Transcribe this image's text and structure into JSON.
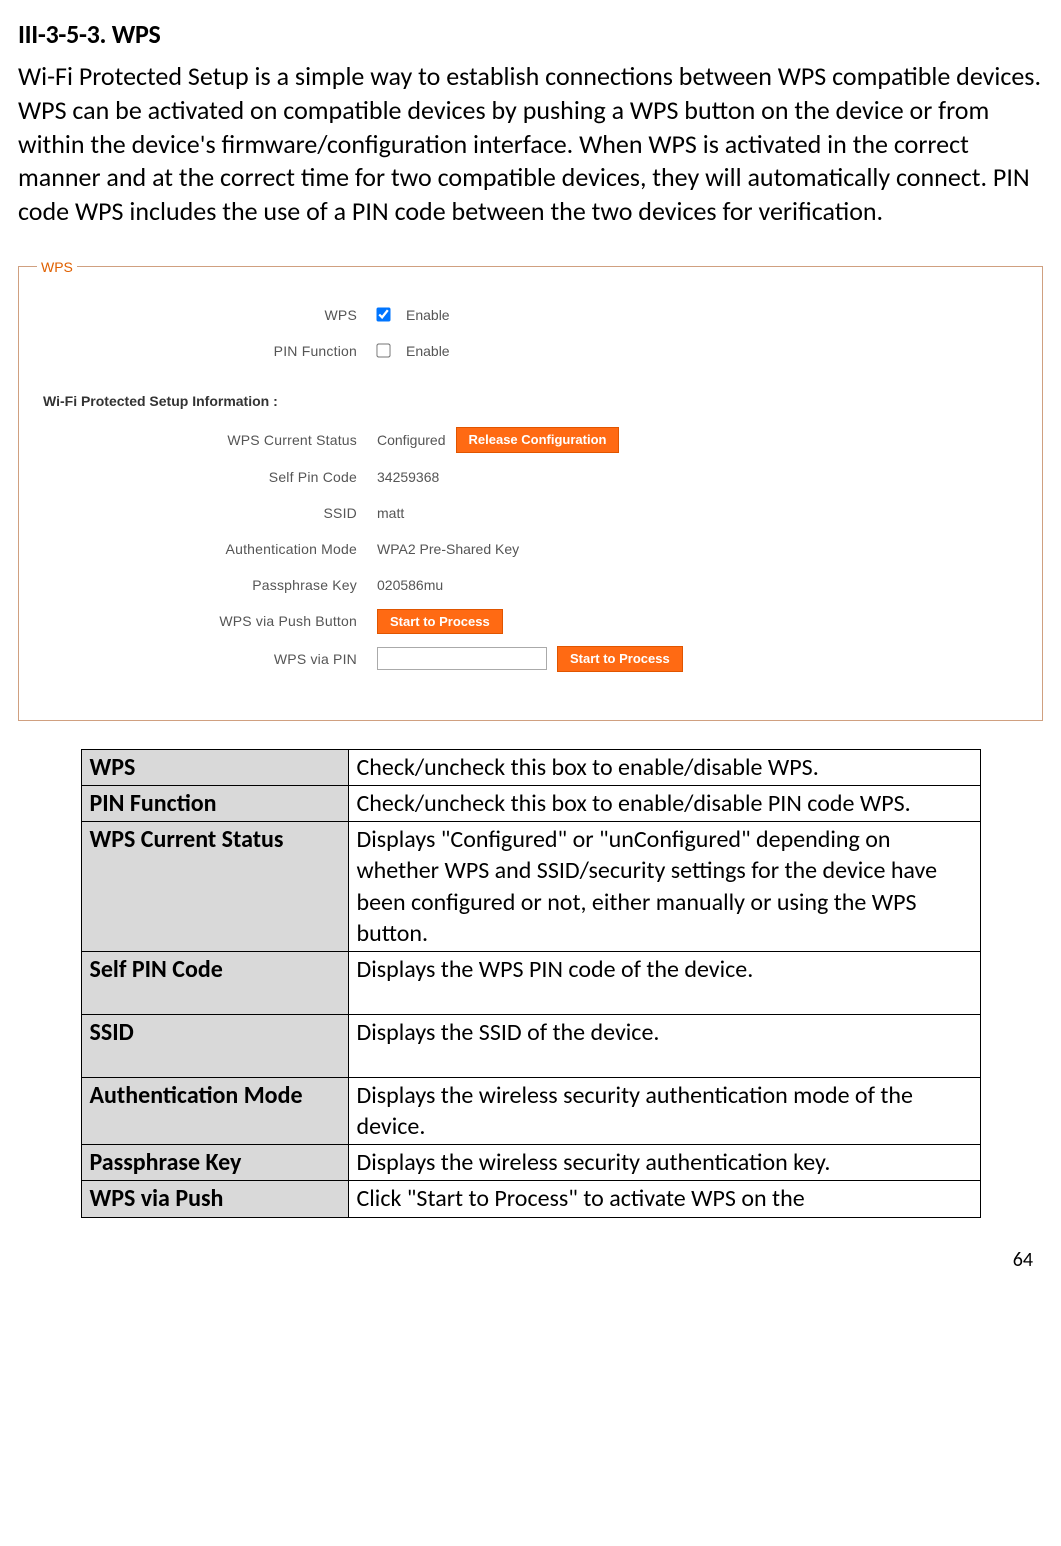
{
  "heading": "III-3-5-3.    WPS",
  "intro": "Wi-Fi Protected Setup is a simple way to establish connections between WPS compatible devices. WPS can be activated on compatible devices by pushing a WPS button on the device or from within the device's firmware/configuration interface. When WPS is activated in the correct manner and at the correct time for two compatible devices, they will automatically connect. PIN code WPS includes the use of a PIN code between the two devices for verification.",
  "fieldset": {
    "legend": "WPS",
    "rows": {
      "wps_label": "WPS",
      "wps_enable": "Enable",
      "pinfunc_label": "PIN Function",
      "pinfunc_enable": "Enable"
    },
    "info_head": "Wi-Fi Protected Setup Information   :",
    "info": {
      "status_label": "WPS Current Status",
      "status_value": "Configured",
      "status_btn": "Release Configuration",
      "selfpin_label": "Self Pin Code",
      "selfpin_value": "34259368",
      "ssid_label": "SSID",
      "ssid_value": "matt",
      "auth_label": "Authentication Mode",
      "auth_value": "WPA2 Pre-Shared Key",
      "pass_label": "Passphrase Key",
      "pass_value": "020586mu",
      "push_label": "WPS via Push Button",
      "push_btn": "Start to Process",
      "pin_label": "WPS via PIN",
      "pin_btn": "Start to Process"
    }
  },
  "table": [
    {
      "k": "WPS",
      "v": "Check/uncheck this box to enable/disable WPS."
    },
    {
      "k": "PIN Function",
      "v": "Check/uncheck this box to enable/disable PIN code WPS."
    },
    {
      "k": "WPS Current Status",
      "v": "Displays \"Configured\" or \"unConfigured\" depending on whether WPS and SSID/security settings for the device have been configured or not, either manually or using the WPS button."
    },
    {
      "k": "Self PIN Code",
      "v": "Displays the WPS PIN code of the device."
    },
    {
      "k": "SSID",
      "v": "Displays the SSID of the device."
    },
    {
      "k": "Authentication Mode",
      "v": "Displays the wireless security authentication mode of the device."
    },
    {
      "k": "Passphrase Key",
      "v": "Displays the wireless security authentication key."
    },
    {
      "k": "WPS via Push",
      "v": "Click \"Start to Process\" to activate WPS on the"
    }
  ],
  "pagenum": "64"
}
